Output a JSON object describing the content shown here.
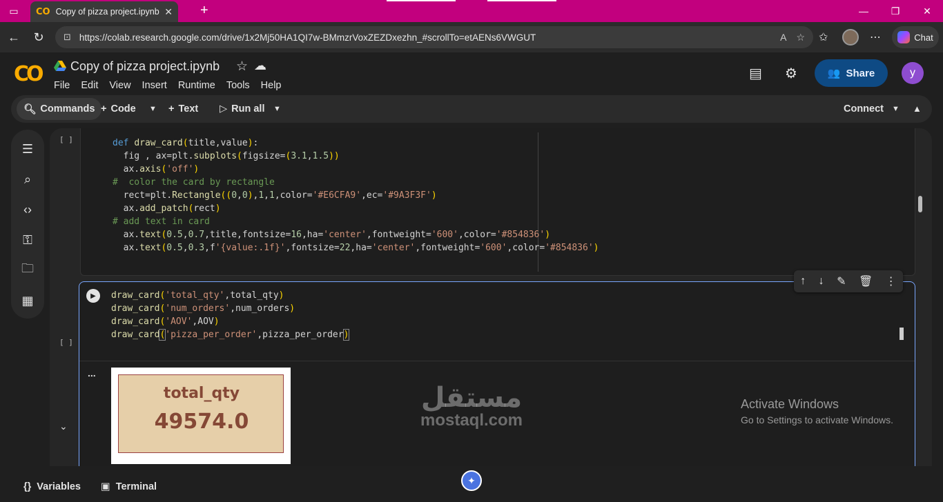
{
  "browser": {
    "tab_title": "Copy of pizza project.ipynb - Cola",
    "tab_favicon": "CO",
    "new_tab_symbol": "+",
    "url": "https://colab.research.google.com/drive/1x2Mj50HA1QI7w-BMmzrVoxZEZDxezhn_#scrollTo=etAENs6VWGUT",
    "chat_label": "Chat"
  },
  "colab": {
    "logo": "CO",
    "notebook_title": "Copy of pizza project.ipynb",
    "menus": [
      "File",
      "Edit",
      "View",
      "Insert",
      "Runtime",
      "Tools",
      "Help"
    ],
    "share_label": "Share",
    "user_initial": "y",
    "toolbar": {
      "commands": "Commands",
      "code": "Code",
      "text": "Text",
      "run_all": "Run all",
      "connect": "Connect"
    }
  },
  "cells": {
    "cell1_bracket": "[ ]",
    "cell2_bracket": "[ ]",
    "output_ellipsis": "...",
    "card": {
      "title": "total_qty",
      "value": "49574.0",
      "face_color": "#E6CFA9",
      "edge_color": "#9A3F3F",
      "text_color": "#854836"
    }
  },
  "bottom": {
    "variables": "Variables",
    "terminal": "Terminal"
  },
  "os_overlay": {
    "activate_title": "Activate Windows",
    "activate_sub": "Go to Settings to activate Windows."
  },
  "watermark": {
    "arabic": "مستقل",
    "latin": "mostaql.com"
  },
  "colors": {
    "tab_bar": "#C2007E",
    "share_button": "#0E4A84",
    "avatar": "#8E4DD0",
    "logo": "#F9AB00"
  }
}
